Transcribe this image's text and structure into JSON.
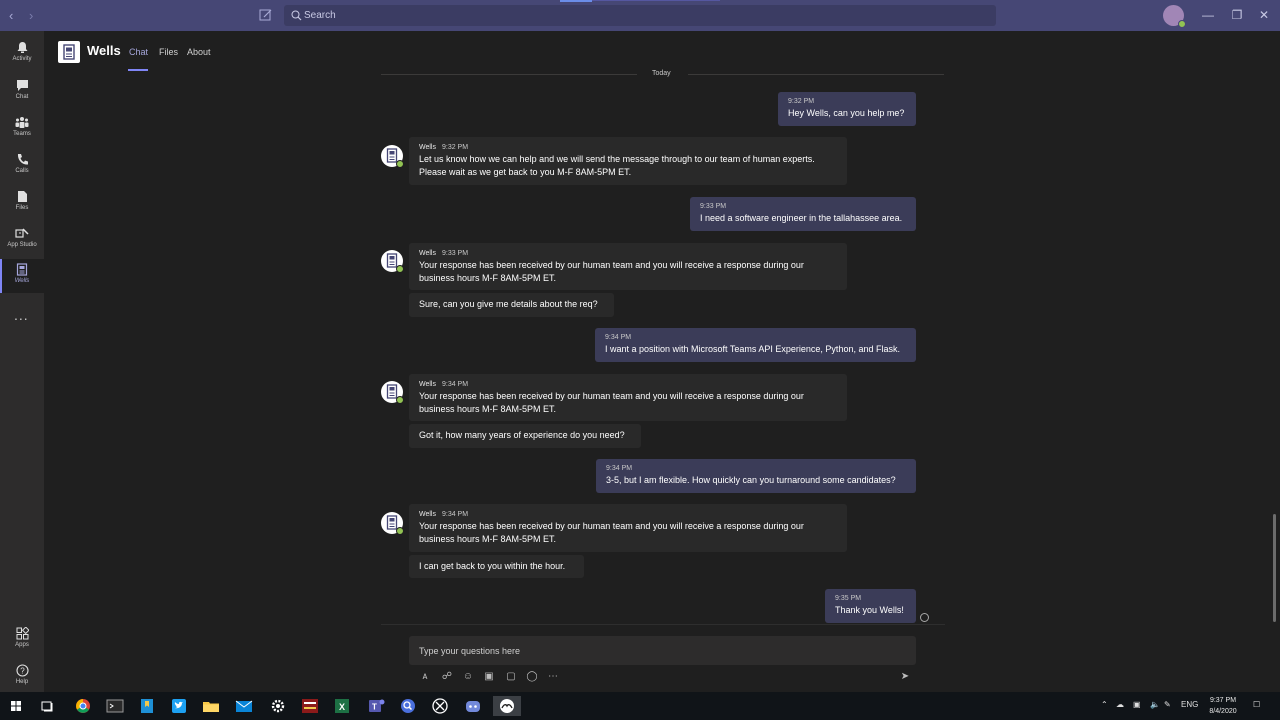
{
  "titlebar": {
    "search_placeholder": "Search"
  },
  "rail": {
    "items": [
      {
        "label": "Activity"
      },
      {
        "label": "Chat"
      },
      {
        "label": "Teams"
      },
      {
        "label": "Calls"
      },
      {
        "label": "Files"
      },
      {
        "label": "App Studio"
      },
      {
        "label": "Wells"
      },
      {
        "label": "Apps"
      },
      {
        "label": "Help"
      }
    ],
    "more": "..."
  },
  "header": {
    "title": "Wells",
    "tabs": [
      "Chat",
      "Files",
      "About"
    ]
  },
  "chat": {
    "day_label": "Today",
    "messages": [
      {
        "from": "me",
        "time": "9:32 PM",
        "text": "Hey Wells, can you help me?"
      },
      {
        "from": "bot",
        "sender": "Wells",
        "time": "9:32 PM",
        "text": "Let us know how we can help and we will send the message through to our team of human experts.\nPlease wait as we get back to you M-F 8AM-5PM ET."
      },
      {
        "from": "me",
        "time": "9:33 PM",
        "text": "I need a software engineer in the tallahassee area."
      },
      {
        "from": "bot",
        "sender": "Wells",
        "time": "9:33 PM",
        "text": "Your response has been received by our human team and you will receive a response during our\nbusiness hours M-F 8AM-5PM ET.",
        "followup": "Sure, can you give me details about the req?"
      },
      {
        "from": "me",
        "time": "9:34 PM",
        "text": "I want a position with Microsoft Teams API Experience, Python, and Flask."
      },
      {
        "from": "bot",
        "sender": "Wells",
        "time": "9:34 PM",
        "text": "Your response has been received by our human team and you will receive a response during our\nbusiness hours M-F 8AM-5PM ET.",
        "followup": "Got it, how many years of experience do you need?"
      },
      {
        "from": "me",
        "time": "9:34 PM",
        "text": "3-5, but I am flexible. How quickly can you turnaround some candidates?"
      },
      {
        "from": "bot",
        "sender": "Wells",
        "time": "9:34 PM",
        "text": "Your response has been received by our human team and you will receive a response during our\nbusiness hours M-F 8AM-5PM ET.",
        "followup": "I can get back to you within the hour."
      },
      {
        "from": "me",
        "time": "9:35 PM",
        "text": "Thank you Wells!"
      }
    ]
  },
  "compose": {
    "placeholder": "Type your questions here"
  },
  "taskbar": {
    "lang": "ENG",
    "time": "9:37 PM",
    "date": "8/4/2020"
  },
  "colors": {
    "titlebar": "#464775",
    "accent": "#7f85f5",
    "my_bubble": "#3b3c58",
    "bot_bubble": "#292929",
    "presence": "#92c353"
  }
}
